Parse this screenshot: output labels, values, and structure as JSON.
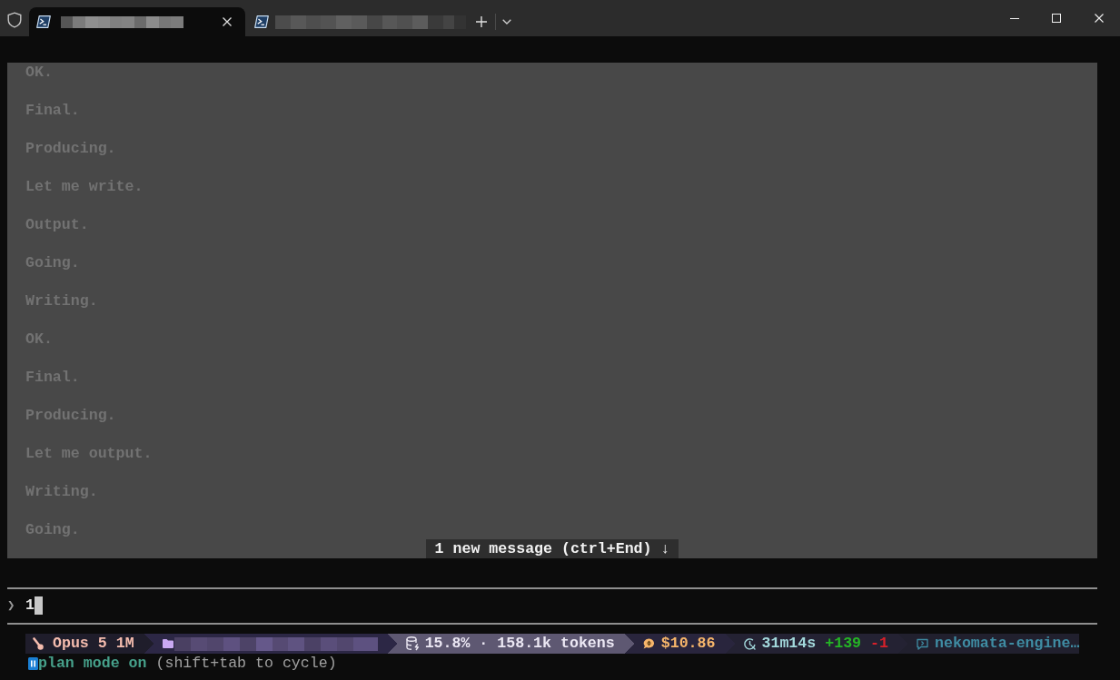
{
  "window": {
    "tabs": [
      {
        "selected": true,
        "title_pixelated": true
      },
      {
        "selected": false,
        "title_pixelated": true
      }
    ]
  },
  "output": {
    "lines": [
      "OK.",
      "Final.",
      "Producing.",
      "Let me write.",
      "Output.",
      "Going.",
      "Writing.",
      "OK.",
      "Final.",
      "Producing.",
      "Let me output.",
      "Writing.",
      "Going."
    ],
    "new_message_notice": "1 new message (ctrl+End) ↓"
  },
  "prompt": {
    "symbol": "❯",
    "input": "1"
  },
  "status_line": {
    "segments": [
      {
        "kind": "model",
        "text": "Opus 5 1M"
      },
      {
        "kind": "directory",
        "pixelated": true
      },
      {
        "kind": "context",
        "text": "15.8% · 158.1k tokens"
      },
      {
        "kind": "cost",
        "text": "$10.86"
      },
      {
        "kind": "time",
        "text": "31m14s",
        "added": "+139",
        "removed": "-1"
      },
      {
        "kind": "session",
        "text": "nekomata-engine…"
      }
    ]
  },
  "mode": {
    "label": "plan mode on",
    "hint": "(shift+tab to cycle)"
  }
}
